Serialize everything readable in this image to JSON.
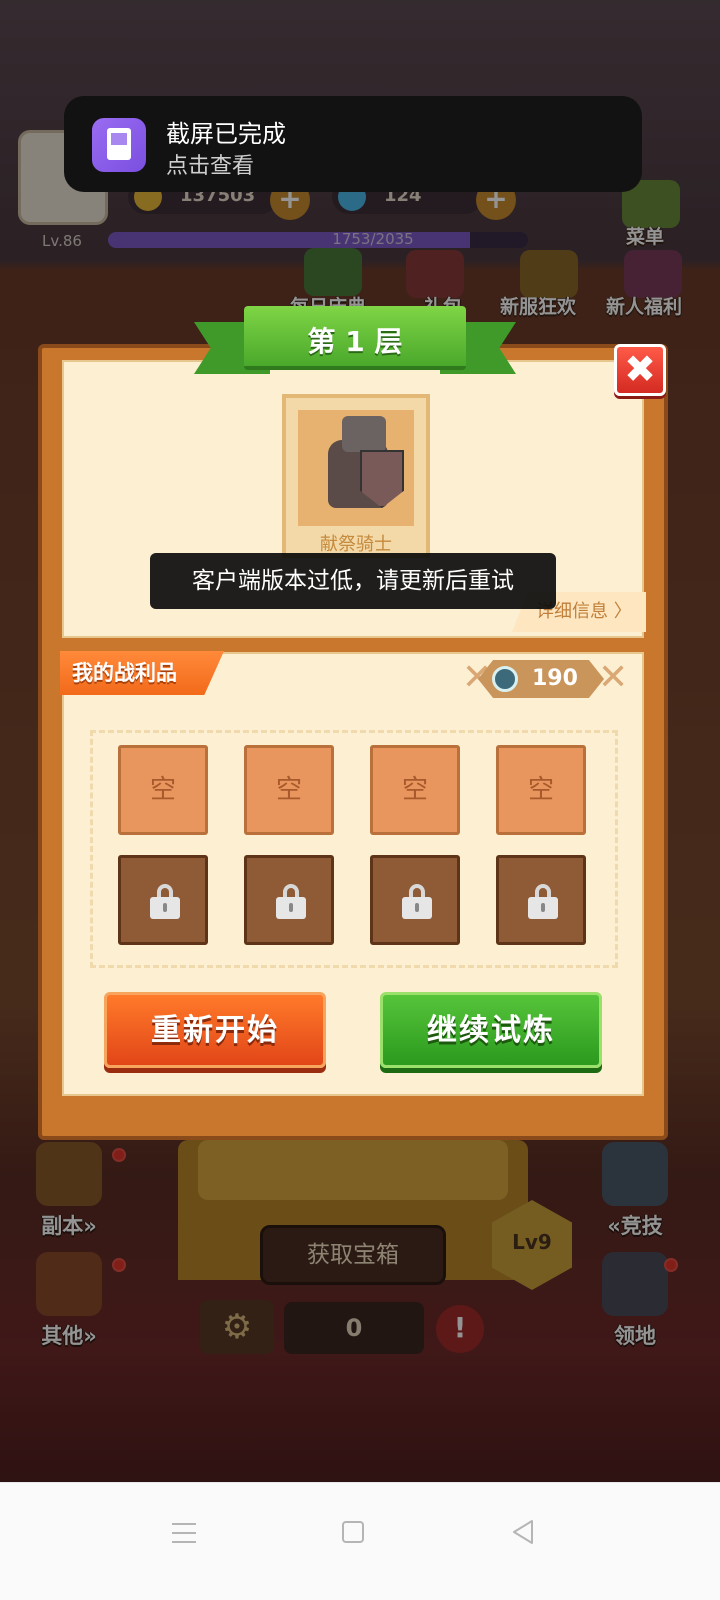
{
  "notification": {
    "title": "截屏已完成",
    "subtitle": "点击查看"
  },
  "hud": {
    "level": "Lv.86",
    "gold": "137503",
    "gems": "124",
    "xp_text": "1753/2035",
    "xp_fraction": 0.861,
    "menu_label": "菜单",
    "top_buttons": [
      {
        "label": "每日庆典",
        "icon": "christmas-tree-icon"
      },
      {
        "label": "礼包",
        "icon": "gift-pack-icon"
      },
      {
        "label": "新服狂欢",
        "icon": "firework-icon"
      },
      {
        "label": "新人福利",
        "icon": "gift-box-icon"
      }
    ]
  },
  "sidebar": {
    "left": [
      {
        "label": "副本»",
        "icon": "dungeon-shield-icon"
      },
      {
        "label": "其他»",
        "icon": "other-house-icon"
      }
    ],
    "right": [
      {
        "label": "«竞技",
        "icon": "crossed-swords-icon"
      },
      {
        "label": "领地",
        "icon": "territory-icon"
      }
    ]
  },
  "bottom_bar": {
    "get_chest": "获取宝箱",
    "level_badge": "Lv9",
    "count": "0",
    "warning": "!"
  },
  "dialog": {
    "title": "第 1 层",
    "close_symbol": "✖",
    "portrait_name": "献祭骑士",
    "details_label": "详细信息 〉",
    "toast": "客户端版本过低，请更新后重试",
    "loot_title": "我的战利品",
    "score": "190",
    "empty_slot_label": "空",
    "restart_label": "重新开始",
    "continue_label": "继续试炼"
  },
  "colors": {
    "accent_green": "#4aa82b",
    "accent_orange": "#e24618",
    "panel_cream": "#fcefd2",
    "panel_brown": "#c9772c"
  }
}
